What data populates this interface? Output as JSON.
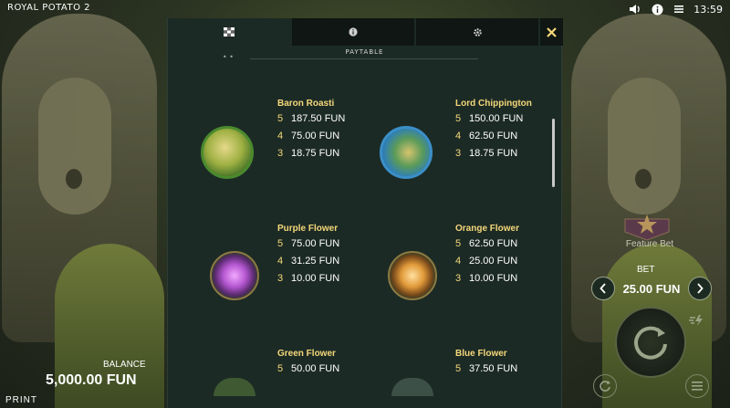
{
  "app": {
    "title": "ROYAL POTATO 2",
    "clock": "13:59"
  },
  "top_icons": [
    "speaker-icon",
    "info-icon",
    "menu-icon"
  ],
  "tabs": [
    {
      "name": "paytable-tab",
      "icon": "checker-icon",
      "active": true
    },
    {
      "name": "info-tab",
      "icon": "info-icon",
      "active": false
    },
    {
      "name": "settings-tab",
      "icon": "gear-icon",
      "active": false
    }
  ],
  "modal": {
    "section_title": "PAYTABLE",
    "close_icon": "close-icon"
  },
  "paytable": [
    {
      "name": "Baron Roasti",
      "icon": "baron-roasti-symbol",
      "color": "#8fb24a",
      "pays": [
        {
          "count": "5",
          "amount": "187.50 FUN"
        },
        {
          "count": "4",
          "amount": "75.00 FUN"
        },
        {
          "count": "3",
          "amount": "18.75 FUN"
        }
      ]
    },
    {
      "name": "Lord Chippington",
      "icon": "lord-chippington-symbol",
      "color": "#3b8fc7",
      "pays": [
        {
          "count": "5",
          "amount": "150.00 FUN"
        },
        {
          "count": "4",
          "amount": "62.50 FUN"
        },
        {
          "count": "3",
          "amount": "18.75 FUN"
        }
      ]
    },
    {
      "name": "Purple Flower",
      "icon": "purple-flower-symbol",
      "color": "#b457d1",
      "pays": [
        {
          "count": "5",
          "amount": "75.00 FUN"
        },
        {
          "count": "4",
          "amount": "31.25 FUN"
        },
        {
          "count": "3",
          "amount": "10.00 FUN"
        }
      ]
    },
    {
      "name": "Orange Flower",
      "icon": "orange-flower-symbol",
      "color": "#e19a3a",
      "pays": [
        {
          "count": "5",
          "amount": "62.50 FUN"
        },
        {
          "count": "4",
          "amount": "25.00 FUN"
        },
        {
          "count": "3",
          "amount": "10.00 FUN"
        }
      ]
    },
    {
      "name": "Green Flower",
      "icon": "green-flower-symbol",
      "color": "#5aa84c",
      "pays": [
        {
          "count": "5",
          "amount": "50.00 FUN"
        }
      ]
    },
    {
      "name": "Blue Flower",
      "icon": "blue-flower-symbol",
      "color": "#4a8fd0",
      "pays": [
        {
          "count": "5",
          "amount": "37.50 FUN"
        }
      ]
    }
  ],
  "controls": {
    "feature_bet_label": "Feature Bet",
    "bet_label": "BET",
    "bet_value": "25.00 FUN",
    "balance_label": "BALANCE",
    "balance_value": "5,000.00 FUN",
    "print_label": "PRINT"
  },
  "colors": {
    "accent": "#f4d87a",
    "panel": "#1c2a25",
    "tab_inactive": "#0f1613"
  }
}
